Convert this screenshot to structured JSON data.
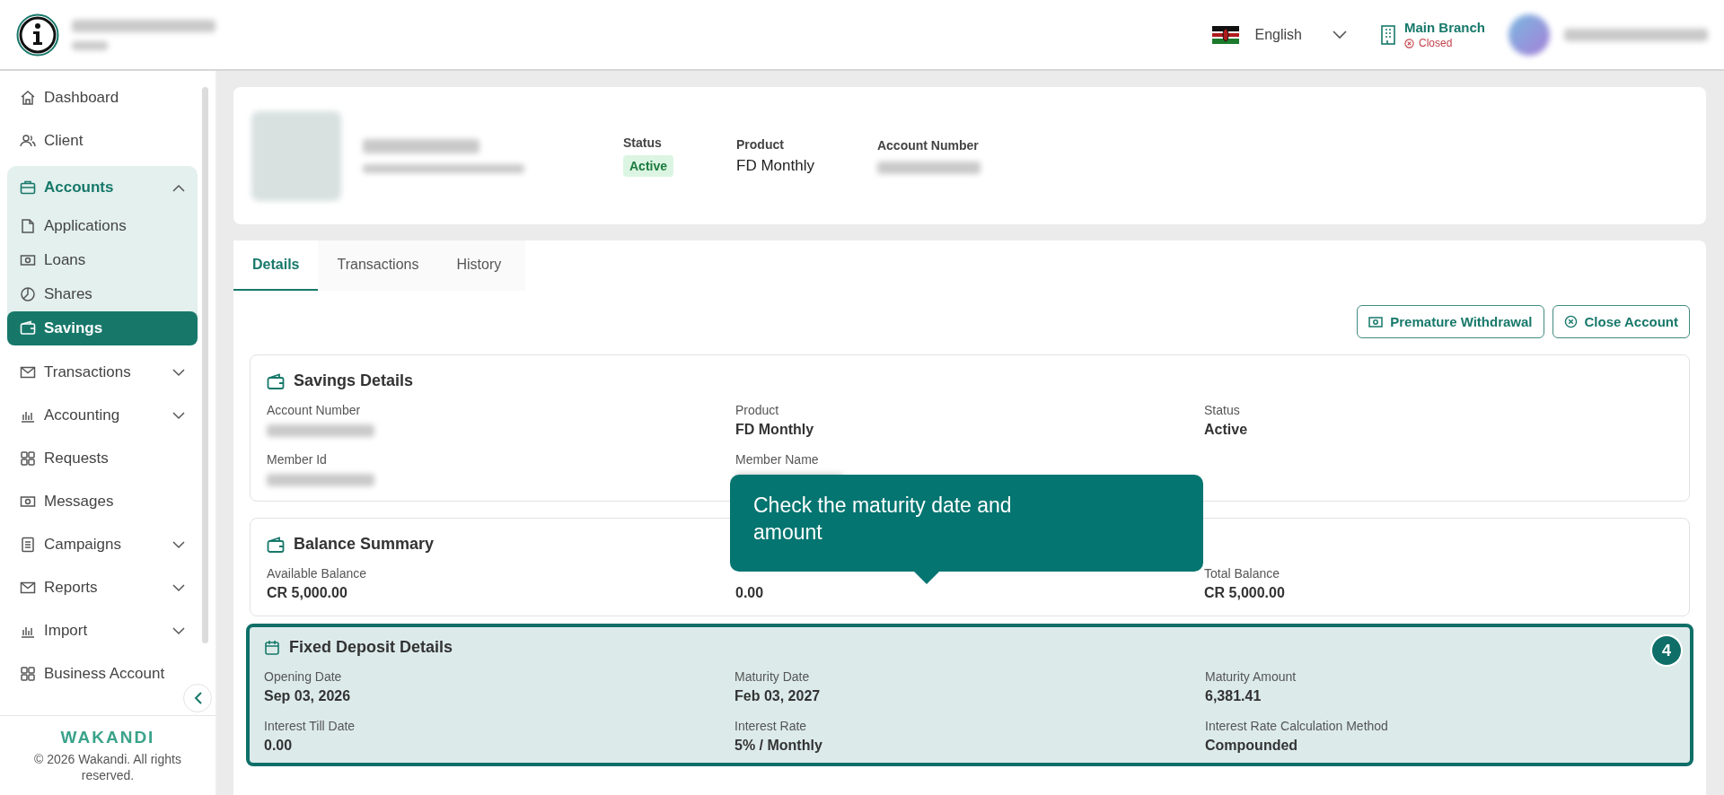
{
  "header": {
    "language": "English",
    "branch": {
      "name": "Main Branch",
      "status": "Closed"
    }
  },
  "sidebar": {
    "items": [
      {
        "label": "Dashboard",
        "selected": false
      },
      {
        "label": "Client",
        "selected": false
      },
      {
        "label": "Accounts",
        "selected": true,
        "expanded": true,
        "children": [
          {
            "label": "Applications",
            "selected": false
          },
          {
            "label": "Loans",
            "selected": false
          },
          {
            "label": "Shares",
            "selected": false
          },
          {
            "label": "Savings",
            "selected": true
          }
        ]
      },
      {
        "label": "Transactions",
        "selected": false,
        "expanded": false
      },
      {
        "label": "Accounting",
        "selected": false,
        "expanded": false
      },
      {
        "label": "Requests",
        "selected": false
      },
      {
        "label": "Messages",
        "selected": false
      },
      {
        "label": "Campaigns",
        "selected": false,
        "expanded": false
      },
      {
        "label": "Reports",
        "selected": false,
        "expanded": false
      },
      {
        "label": "Import",
        "selected": false,
        "expanded": false
      },
      {
        "label": "Business Account",
        "selected": false
      }
    ],
    "brand": "WAKANDI",
    "copyright": "© 2026 Wakandi. All rights reserved."
  },
  "profile": {
    "status_label": "Status",
    "status": "Active",
    "product_label": "Product",
    "product": "FD Monthly",
    "account_number_label": "Account Number"
  },
  "tabs": [
    {
      "label": "Details",
      "selected": true
    },
    {
      "label": "Transactions",
      "selected": false
    },
    {
      "label": "History",
      "selected": false
    }
  ],
  "actions": [
    "Premature Withdrawal",
    "Close Account"
  ],
  "sections": [
    {
      "title": "Savings Details",
      "highlighted": false,
      "fields": [
        {
          "label": "Account Number",
          "blurred": true
        },
        {
          "label": "Product",
          "value": "FD Monthly"
        },
        {
          "label": "Status",
          "value": "Active"
        },
        {
          "label": "Member Id",
          "blurred": true
        },
        {
          "label": "Member Name",
          "blurred": true
        }
      ]
    },
    {
      "title": "Balance Summary",
      "highlighted": false,
      "fields": [
        {
          "label": "Available Balance",
          "value": "CR 5,000.00"
        },
        {
          "value": "0.00"
        },
        {
          "label": "Total Balance",
          "value": "CR 5,000.00"
        }
      ]
    },
    {
      "title": "Fixed Deposit Details",
      "highlighted": true,
      "fields": [
        {
          "label": "Opening Date",
          "value": "Sep 03, 2026"
        },
        {
          "label": "Maturity Date",
          "value": "Feb 03, 2027"
        },
        {
          "label": "Maturity Amount",
          "value": "6,381.41"
        },
        {
          "label": "Interest Till Date",
          "value": "0.00"
        },
        {
          "label": "Interest Rate",
          "value": "5% / Monthly"
        },
        {
          "label": "Interest Rate Calculation Method",
          "value": "Compounded"
        }
      ]
    }
  ],
  "tooltip": {
    "text": "Check the maturity date and amount",
    "step": "4"
  }
}
